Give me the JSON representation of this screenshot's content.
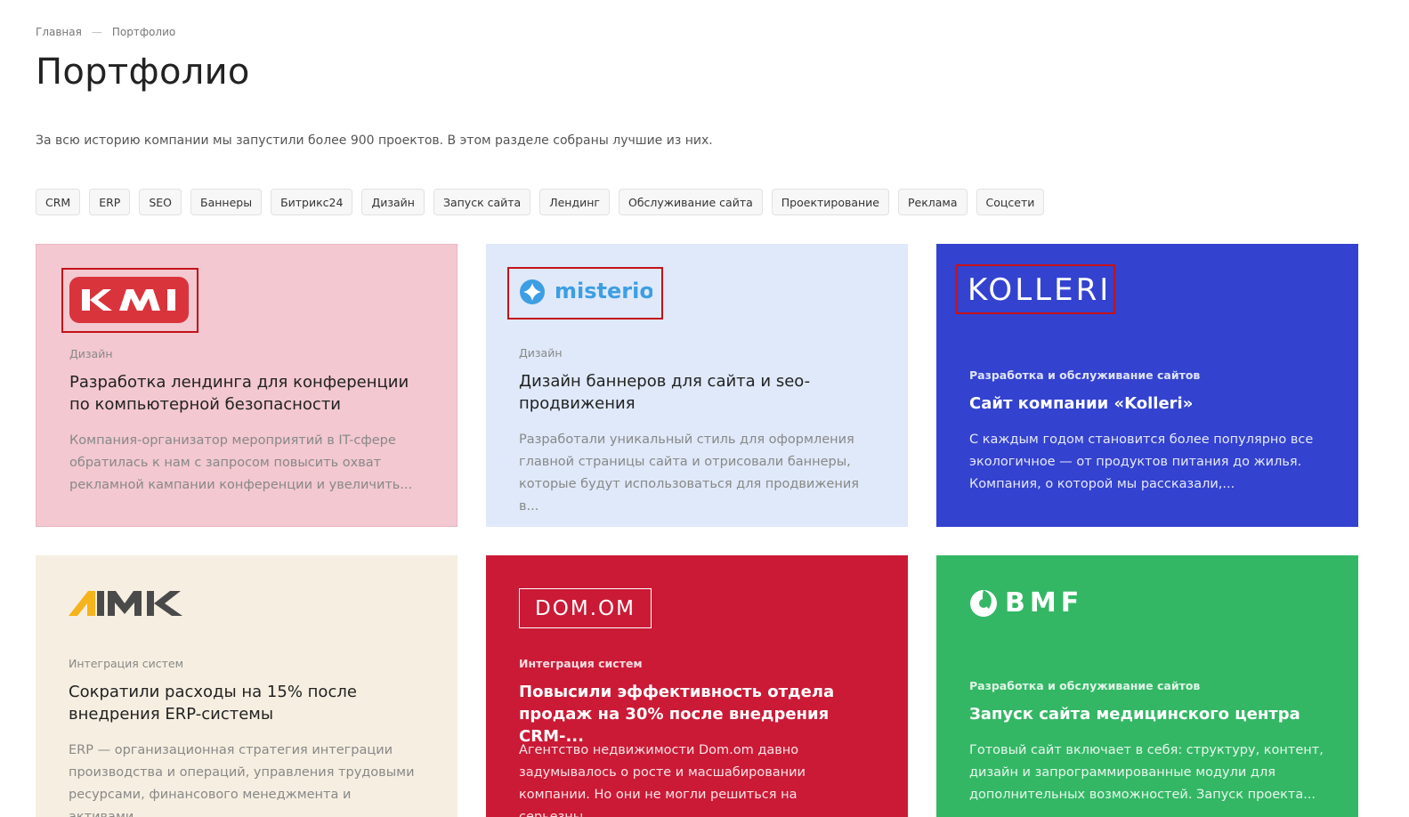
{
  "breadcrumb": {
    "home": "Главная",
    "separator": "—",
    "current": "Портфолио"
  },
  "page_title": "Портфолио",
  "intro": "За всю историю компании мы запустили более 900 проектов. В этом разделе собраны лучшие из них.",
  "filters": [
    "CRM",
    "ERP",
    "SEO",
    "Баннеры",
    "Битрикс24",
    "Дизайн",
    "Запуск сайта",
    "Лендинг",
    "Обслуживание сайта",
    "Проектирование",
    "Реклама",
    "Соцсети"
  ],
  "cards": [
    {
      "logo": "KMI",
      "category": "Дизайн",
      "title": "Разработка лендинга для конференции по компьютерной безопасности",
      "description": "Компания-организатор мероприятий в IT-сфере обратилась к нам с запросом повысить охват рекламной кампании конференции и увеличить...",
      "bg": "#f3c8d0"
    },
    {
      "logo": "misterio",
      "category": "Дизайн",
      "title": "Дизайн баннеров для сайта и seo-продвижения",
      "description": "Разработали уникальный стиль для оформления главной страницы сайта и отрисовали баннеры, которые будут использоваться для продвижения в...",
      "bg": "#dfe9f9"
    },
    {
      "logo": "KOLLERI",
      "category": "Разработка и обслуживание сайтов",
      "title": "Сайт компании «Kolleri»",
      "description": "С каждым годом становится более популярно все экологичное — от продуктов питания до жилья. Компания, о которой мы рассказали,...",
      "bg": "#3342cf"
    },
    {
      "logo": "4MK",
      "category": "Интеграция систем",
      "title": "Сократили расходы на 15% после внедрения ERP-системы",
      "description": "ERP — организационная стратегия интеграции производства и операций, управления трудовыми ресурсами, финансового менеджмента и активами...",
      "bg": "#f6efe1"
    },
    {
      "logo": "DOM.OM",
      "category": "Интеграция систем",
      "title": "Повысили эффективность отдела продаж на 30% после внедрения CRM-...",
      "description": "Агентство недвижимости Dom.om давно задумывалось о росте и масшабировании компании. Но они не могли решиться на серьезны...",
      "bg": "#cb1a36"
    },
    {
      "logo": "BMF",
      "category": "Разработка и обслуживание сайтов",
      "title": "Запуск сайта медицинского центра",
      "description": "Готовый сайт включает в себя: структуру, контент, дизайн и запрограммированные модули для дополнительных возможностей. Запуск проекта...",
      "bg": "#33b765"
    }
  ]
}
